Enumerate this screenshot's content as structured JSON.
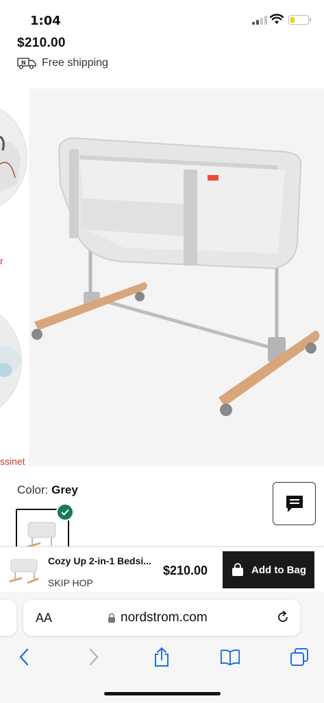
{
  "status_bar": {
    "time": "1:04"
  },
  "product": {
    "price": "$210.00",
    "shipping": "Free shipping",
    "color_label": "Color:",
    "color_value": "Grey"
  },
  "gallery": {
    "thumb_caption_1": "r",
    "thumb_caption_2": "ssinet"
  },
  "sticky_bar": {
    "name": "Cozy Up 2-in-1 Bedsi...",
    "brand": "SKIP HOP",
    "price": "$210.00",
    "add_label": "Add to Bag"
  },
  "browser": {
    "aa_label": "AA",
    "url": "nordstrom.com"
  },
  "colors": {
    "accent": "#1a7a4f",
    "sale_red": "#c0392b",
    "button_dark": "#1a1a1a"
  }
}
